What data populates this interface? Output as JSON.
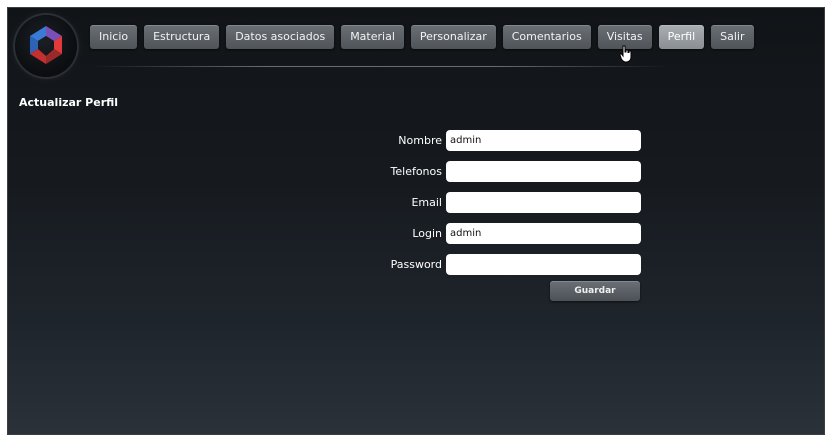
{
  "nav": {
    "items": [
      {
        "label": "Inicio",
        "active": false
      },
      {
        "label": "Estructura",
        "active": false
      },
      {
        "label": "Datos asociados",
        "active": false
      },
      {
        "label": "Material",
        "active": false
      },
      {
        "label": "Personalizar",
        "active": false
      },
      {
        "label": "Comentarios",
        "active": false
      },
      {
        "label": "Visitas",
        "active": false
      },
      {
        "label": "Perfil",
        "active": true
      },
      {
        "label": "Salir",
        "active": false
      }
    ]
  },
  "page": {
    "title": "Actualizar Perfil"
  },
  "form": {
    "fields": [
      {
        "label": "Nombre",
        "value": "admin",
        "type": "text"
      },
      {
        "label": "Telefonos",
        "value": "",
        "type": "text"
      },
      {
        "label": "Email",
        "value": "",
        "type": "text"
      },
      {
        "label": "Login",
        "value": "admin",
        "type": "text"
      },
      {
        "label": "Password",
        "value": "",
        "type": "password"
      }
    ],
    "save_label": "Guardar"
  },
  "icons": {
    "logo": "logo-icon",
    "cursor": "hand-cursor-icon"
  },
  "colors": {
    "background": "#161a1f",
    "button": "#5c6166",
    "button_active": "#9a9fa4",
    "logo_blue": "#3a7bd5",
    "logo_red": "#e03a3a",
    "logo_purple": "#7b4fb8"
  }
}
